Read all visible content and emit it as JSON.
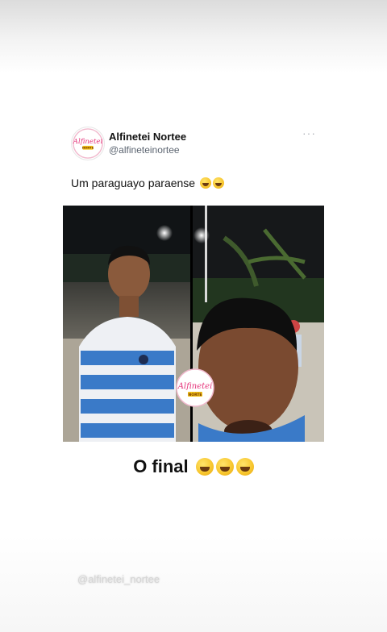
{
  "post": {
    "account_name": "Alfinetei Nortee",
    "handle": "@alfineteinortee",
    "more_label": "···",
    "text": "Um paraguayo paraense",
    "text_emojis": [
      "face-with-tears-of-joy",
      "face-with-tears-of-joy"
    ]
  },
  "video": {
    "caption": "O final",
    "caption_emojis": [
      "face-with-tears-of-joy",
      "face-with-tears-of-joy",
      "face-with-tears-of-joy"
    ],
    "left_panel": "young man in blue and white striped shirt at night",
    "right_panel": "selfie close-up at night with palm trees"
  },
  "watermark": "@alfinetei_nortee",
  "colors": {
    "text": "#111111",
    "handle": "#5b6470",
    "shirt_blue": "#3a7ac8",
    "logo_pink": "#e5337a",
    "logo_yellow": "#f2c21a"
  }
}
